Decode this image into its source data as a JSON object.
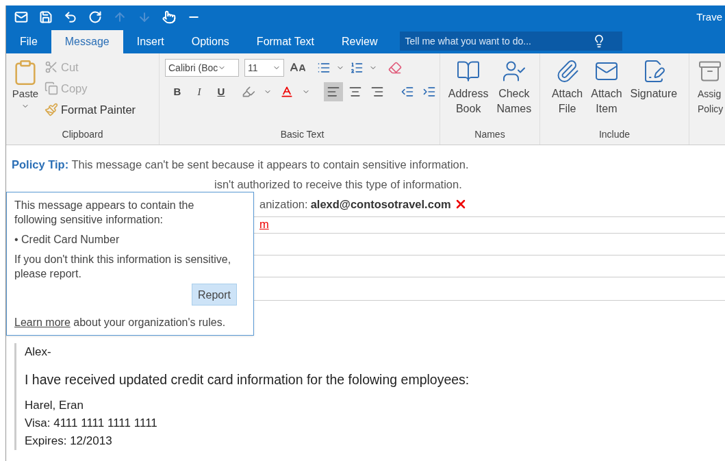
{
  "window": {
    "title": "Trave"
  },
  "quick_access": [
    {
      "kind": "mail",
      "disabled": false
    },
    {
      "kind": "save",
      "disabled": false
    },
    {
      "kind": "undo",
      "disabled": false
    },
    {
      "kind": "redo",
      "disabled": false
    },
    {
      "kind": "up",
      "disabled": true
    },
    {
      "kind": "down",
      "disabled": true
    },
    {
      "kind": "touch",
      "disabled": false
    },
    {
      "kind": "customize",
      "disabled": false
    }
  ],
  "tabs": [
    {
      "label": "File",
      "selected": false
    },
    {
      "label": "Message",
      "selected": true
    },
    {
      "label": "Insert",
      "selected": false
    },
    {
      "label": "Options",
      "selected": false
    },
    {
      "label": "Format Text",
      "selected": false
    },
    {
      "label": "Review",
      "selected": false
    }
  ],
  "search": {
    "placeholder": "Tell me what you want to do..."
  },
  "clipboard": {
    "label": "Clipboard",
    "paste": "Paste",
    "items": [
      {
        "kind": "cut",
        "label": "Cut",
        "disabled": true
      },
      {
        "kind": "copy",
        "label": "Copy",
        "disabled": true
      },
      {
        "kind": "painter",
        "label": "Format Painter",
        "disabled": false
      }
    ]
  },
  "basic_text": {
    "label": "Basic Text",
    "font": "Calibri (Boc",
    "size": "11",
    "styles": [
      "B",
      "I",
      "U"
    ],
    "align": [
      {
        "kind": "left",
        "selected": true
      },
      {
        "kind": "center",
        "selected": false
      },
      {
        "kind": "right",
        "selected": false
      }
    ]
  },
  "names": {
    "label": "Names",
    "buttons": [
      {
        "kind": "book",
        "lines": [
          "Address",
          "Book"
        ]
      },
      {
        "kind": "check",
        "lines": [
          "Check",
          "Names"
        ]
      }
    ]
  },
  "include": {
    "label": "Include",
    "buttons": [
      {
        "kind": "file",
        "lines": [
          "Attach",
          "File"
        ]
      },
      {
        "kind": "item",
        "lines": [
          "Attach",
          "Item"
        ]
      },
      {
        "kind": "signature",
        "lines": [
          "Signature"
        ]
      }
    ]
  },
  "cut_group": {
    "lines": [
      "Assig",
      "Policy"
    ]
  },
  "policy_tip": {
    "label": "Policy Tip:",
    "text": "This message can't be sent because it appears to contain sensitive information."
  },
  "recipient_line": "isn't authorized to receive this type of information.",
  "organization_line": {
    "text": "anization:",
    "email": "alexd@contosotravel.com"
  },
  "to_value": "m",
  "popup": {
    "intro": "This message appears to contain the following sensitive information:",
    "bullet": "• Credit Card Number",
    "note": "If you don't think this information is sensitive, please report.",
    "button": "Report",
    "link": "Learn more",
    "link_suffix": "about your organization's rules."
  },
  "body": {
    "greeting": "Alex-",
    "lead": "I have received updated credit card information for the folowing employees:",
    "lines": [
      "Harel, Eran",
      "Visa: 4111 1111 1111 1111",
      "Expires: 12/2013"
    ]
  }
}
